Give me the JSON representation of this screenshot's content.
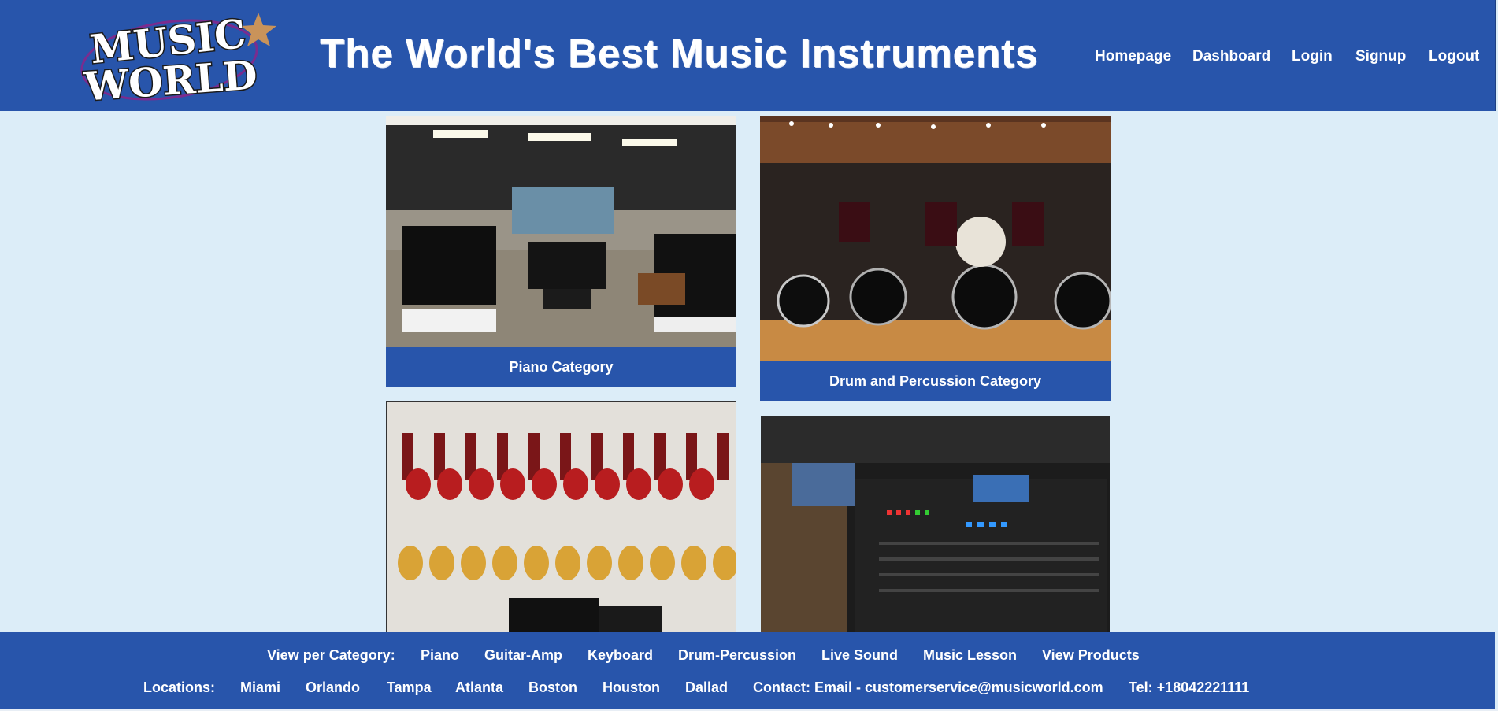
{
  "header": {
    "logo": {
      "line1": "MUSIC",
      "line2": "WORLD",
      "icon": "star-icon"
    },
    "title": "The World's Best Music Instruments",
    "nav": [
      {
        "label": "Homepage"
      },
      {
        "label": "Dashboard"
      },
      {
        "label": "Login"
      },
      {
        "label": "Signup"
      },
      {
        "label": "Logout"
      }
    ]
  },
  "categories": [
    {
      "caption": "Piano Category",
      "image": "piano-showroom-image"
    },
    {
      "caption": "Drum and Percussion Category",
      "image": "drum-showroom-image"
    },
    {
      "caption": "",
      "image": "guitar-wall-image"
    },
    {
      "caption": "",
      "image": "mixing-console-image"
    }
  ],
  "footer": {
    "category_label": "View per Category:",
    "category_links": [
      "Piano",
      "Guitar-Amp",
      "Keyboard",
      "Drum-Percussion",
      "Live Sound",
      "Music Lesson",
      "View Products"
    ],
    "locations_label": "Locations:",
    "locations": [
      "Miami",
      "Orlando",
      "Tampa",
      "Atlanta",
      "Boston",
      "Houston",
      "Dallad"
    ],
    "contact": "Contact: Email - customerservice@musicworld.com",
    "phone": "Tel: +18042221111"
  },
  "colors": {
    "brand_blue": "#2855ab",
    "page_background": "#dcedf8",
    "text_light": "#ffffff"
  }
}
